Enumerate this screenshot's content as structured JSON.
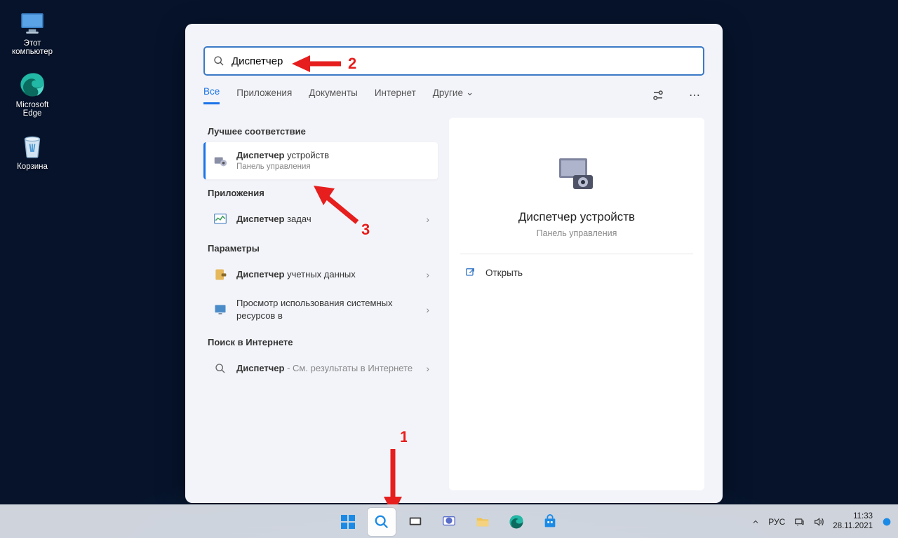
{
  "desktop": {
    "items": [
      {
        "label": "Этот компьютер"
      },
      {
        "label": "Microsoft Edge"
      },
      {
        "label": "Корзина"
      }
    ]
  },
  "search": {
    "input_value": "Диспетчер",
    "tabs": {
      "all": "Все",
      "apps": "Приложения",
      "docs": "Документы",
      "web": "Интернет",
      "other": "Другие"
    },
    "sections": {
      "best_match": "Лучшее соответствие",
      "apps": "Приложения",
      "settings": "Параметры",
      "web_search": "Поиск в Интернете"
    },
    "results": {
      "best": {
        "title_bold": "Диспетчер",
        "title_rest": " устройств",
        "sub": "Панель управления"
      },
      "app1": {
        "title_bold": "Диспетчер",
        "title_rest": " задач"
      },
      "setting1": {
        "title_bold": "Диспетчер",
        "title_rest": " учетных данных"
      },
      "setting2": {
        "title": "Просмотр использования системных ресурсов в"
      },
      "web1": {
        "title_bold": "Диспетчер",
        "title_rest": " - См. результаты в Интернете"
      }
    },
    "preview": {
      "title": "Диспетчер устройств",
      "sub": "Панель управления",
      "open": "Открыть"
    }
  },
  "annotations": {
    "a1": "1",
    "a2": "2",
    "a3": "3"
  },
  "taskbar": {
    "tray": {
      "lang": "РУС",
      "time": "11:33",
      "date": "28.11.2021"
    }
  }
}
